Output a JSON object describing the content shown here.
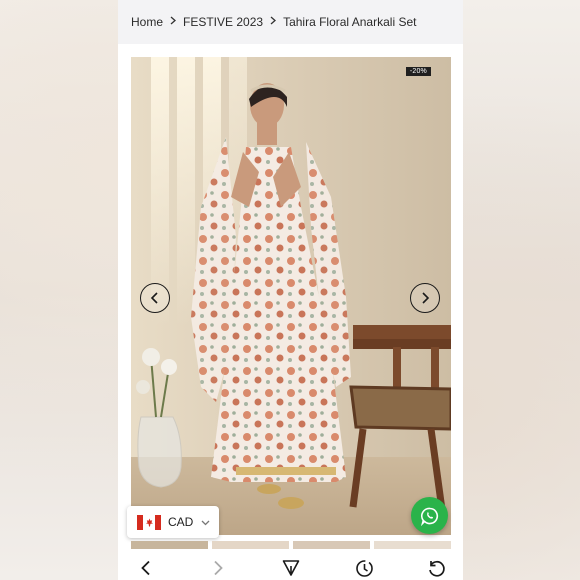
{
  "breadcrumb": {
    "items": [
      "Home",
      "FESTIVE 2023",
      "Tahira Floral Anarkali Set"
    ]
  },
  "product_image": {
    "discount_badge": "-20%",
    "prev_icon": "chevron-left-icon",
    "next_icon": "chevron-right-icon"
  },
  "currency_selector": {
    "code": "CAD",
    "flag_icon": "canada-flag-icon"
  },
  "whatsapp": {
    "icon": "whatsapp-icon",
    "color": "#2ab34a"
  },
  "browser_toolbar": {
    "icons": [
      "back-arrow-icon",
      "forward-arrow-icon",
      "share-send-icon",
      "history-icon",
      "reload-icon"
    ]
  },
  "colors": {
    "breadcrumb_bg": "#f3f3f5",
    "badge_bg": "#1f1f1f"
  }
}
